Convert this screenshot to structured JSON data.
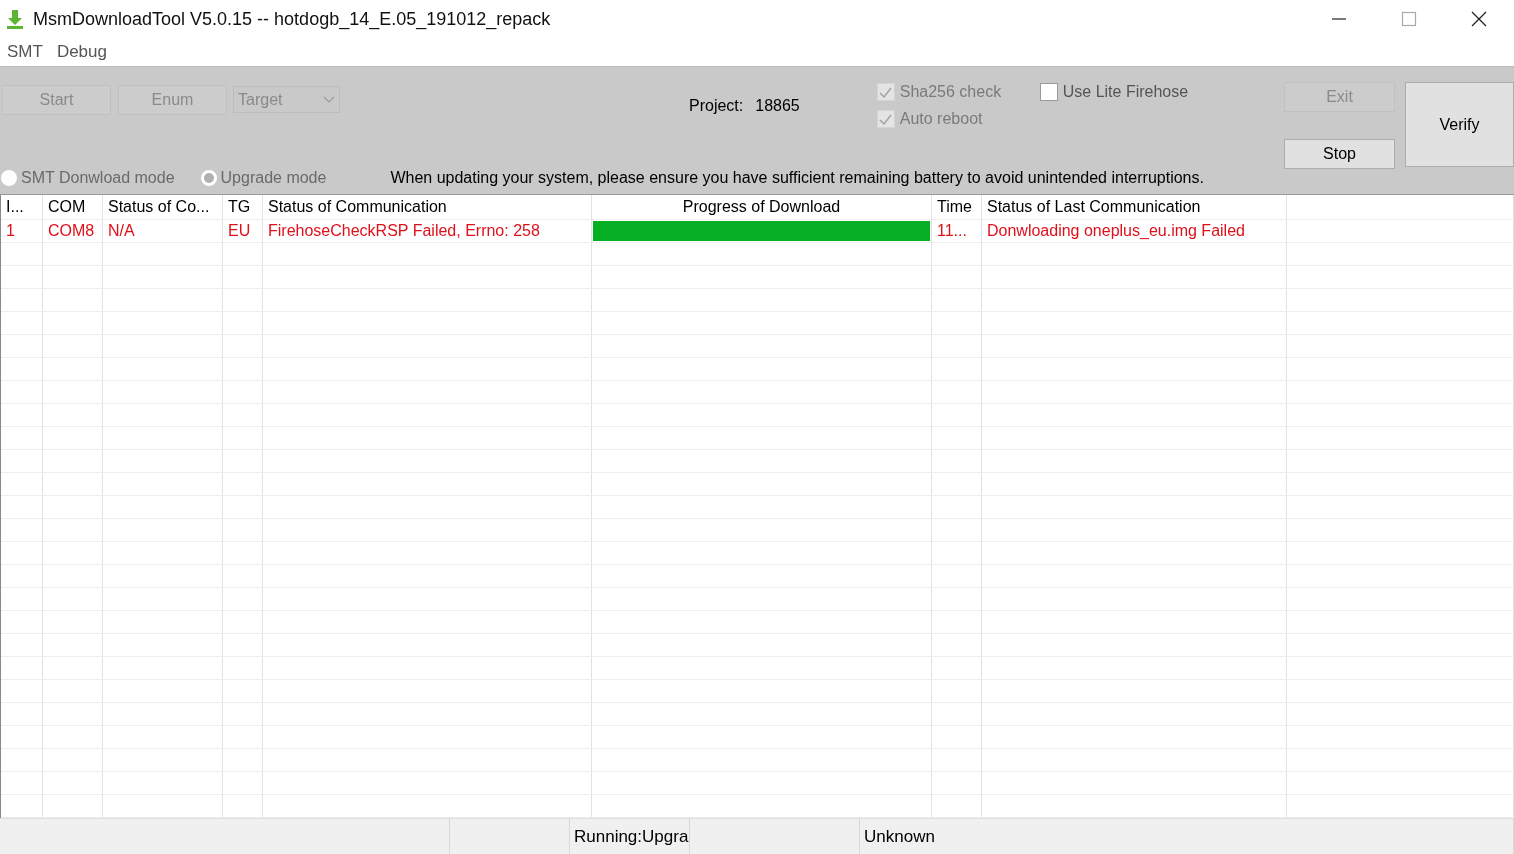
{
  "window": {
    "title": "MsmDownloadTool V5.0.15 -- hotdogb_14_E.05_191012_repack"
  },
  "menu": [
    "SMT",
    "Debug"
  ],
  "panel": {
    "buttons": [
      {
        "label": "Start",
        "disabled": true
      },
      {
        "label": "Enum",
        "disabled": true
      }
    ],
    "target": {
      "value": "Target",
      "disabled": true
    },
    "project": {
      "label": "Project:",
      "value": "18865"
    },
    "checkboxes": [
      {
        "label": "Sha256 check",
        "checked": true,
        "disabled": true
      },
      {
        "label": "Auto reboot",
        "checked": true,
        "disabled": true
      },
      {
        "label": "Use Lite Firehose",
        "checked": false,
        "disabled": false
      }
    ],
    "modes": [
      {
        "label": "SMT Donwload mode",
        "selected": false,
        "disabled": true
      },
      {
        "label": "Upgrade mode",
        "selected": true,
        "disabled": true
      }
    ],
    "notice": "When updating your system, please ensure you have sufficient remaining battery to avoid unintended interruptions.",
    "side_buttons": [
      {
        "label": "Exit",
        "disabled": true
      },
      {
        "label": "Stop",
        "disabled": false
      }
    ],
    "verify_button": {
      "label": "Verify",
      "disabled": false
    }
  },
  "table": {
    "columns": [
      "I...",
      "COM",
      "Status of Co...",
      "TG",
      "Status of Communication",
      "Progress of Download",
      "Time",
      "Status of Last Communication"
    ],
    "rows": [
      {
        "failed": true,
        "id": "1",
        "com": "COM8",
        "status_short": "N/A",
        "tg": "EU",
        "communication": "FirehoseCheckRSP Failed, Errno: 258",
        "progress": {
          "level": 1
        },
        "time": "11...",
        "last_communication": "Donwloading oneplus_eu.img Failed"
      }
    ]
  },
  "status_bar": [
    "Running:Upgra",
    "Unknown"
  ]
}
